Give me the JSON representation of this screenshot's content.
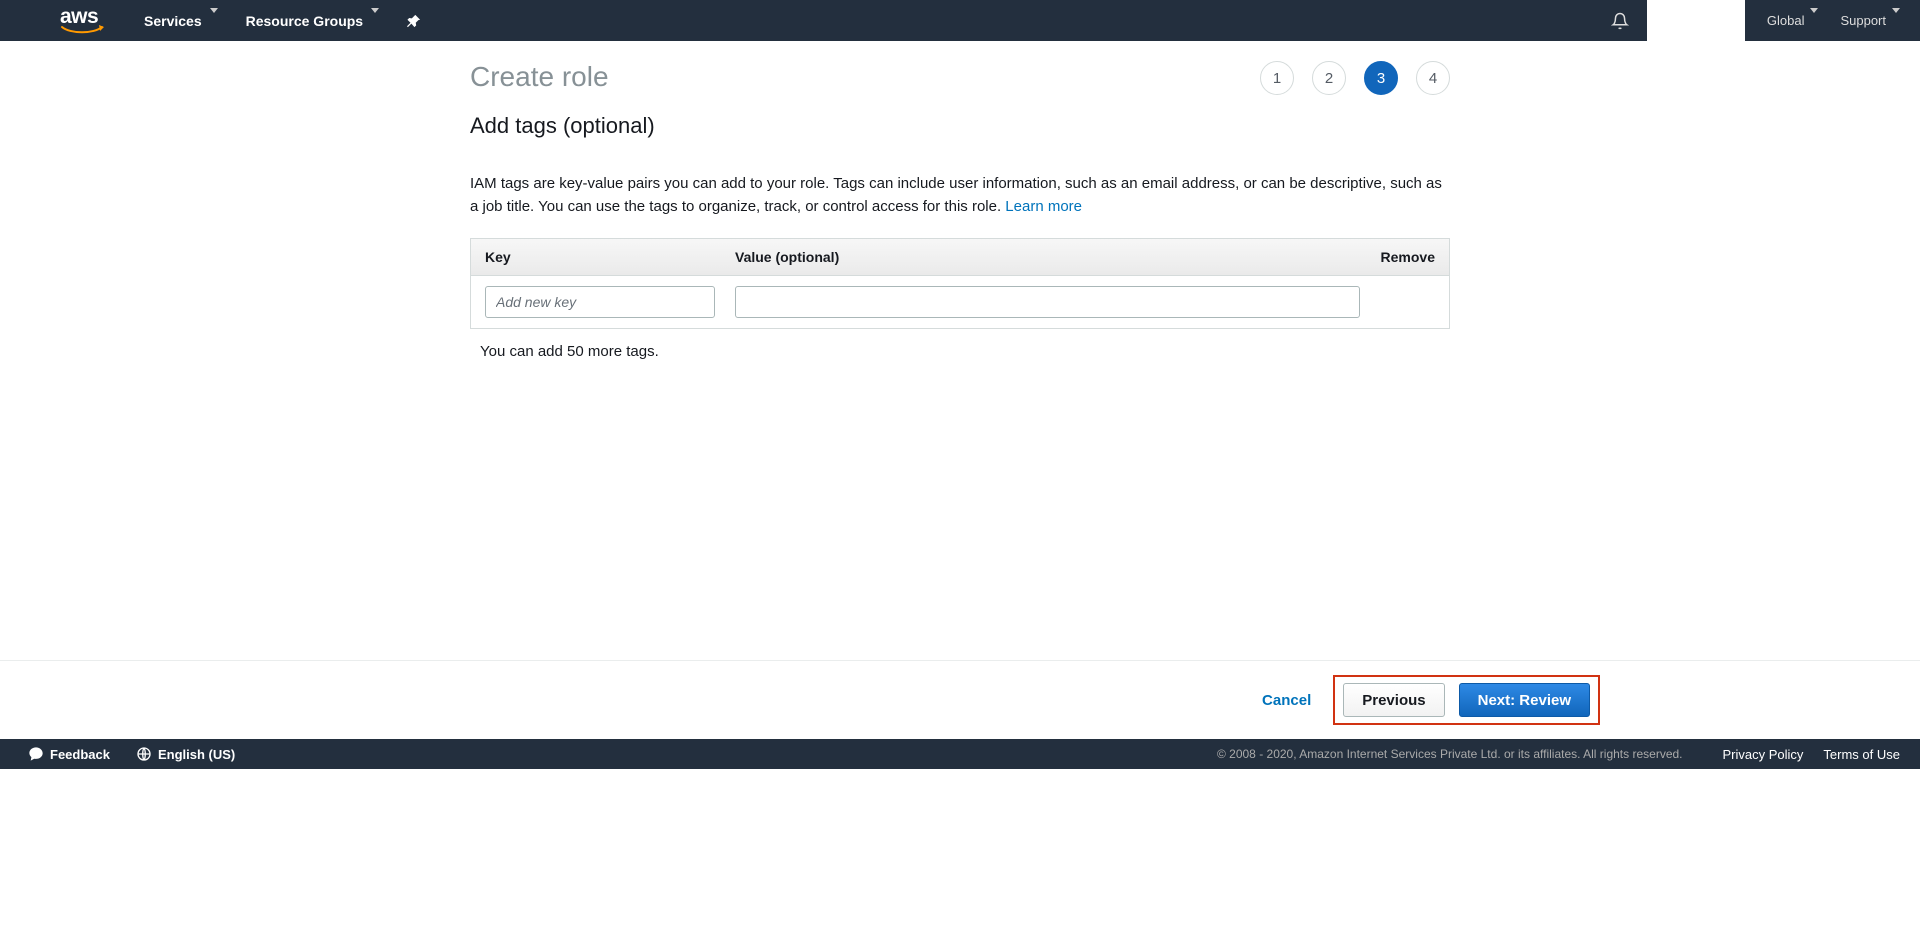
{
  "nav": {
    "logo": "aws",
    "services": "Services",
    "resource_groups": "Resource Groups",
    "global": "Global",
    "support": "Support"
  },
  "page": {
    "title": "Create role",
    "subtitle": "Add tags (optional)",
    "desc_part1": "IAM tags are key-value pairs you can add to your role. Tags can include user information, such as an email address, or can be descriptive, such as a job title. You can use the tags to organize, track, or control access for this role. ",
    "learn_more": "Learn more",
    "steps": [
      "1",
      "2",
      "3",
      "4"
    ],
    "active_step": 3
  },
  "table": {
    "head_key": "Key",
    "head_value": "Value (optional)",
    "head_remove": "Remove",
    "key_placeholder": "Add new key",
    "value_placeholder": "",
    "hint": "You can add 50 more tags."
  },
  "actions": {
    "cancel": "Cancel",
    "previous": "Previous",
    "next": "Next: Review"
  },
  "footer": {
    "feedback": "Feedback",
    "language": "English (US)",
    "copyright": "© 2008 - 2020, Amazon Internet Services Private Ltd. or its affiliates. All rights reserved.",
    "privacy": "Privacy Policy",
    "terms": "Terms of Use"
  }
}
